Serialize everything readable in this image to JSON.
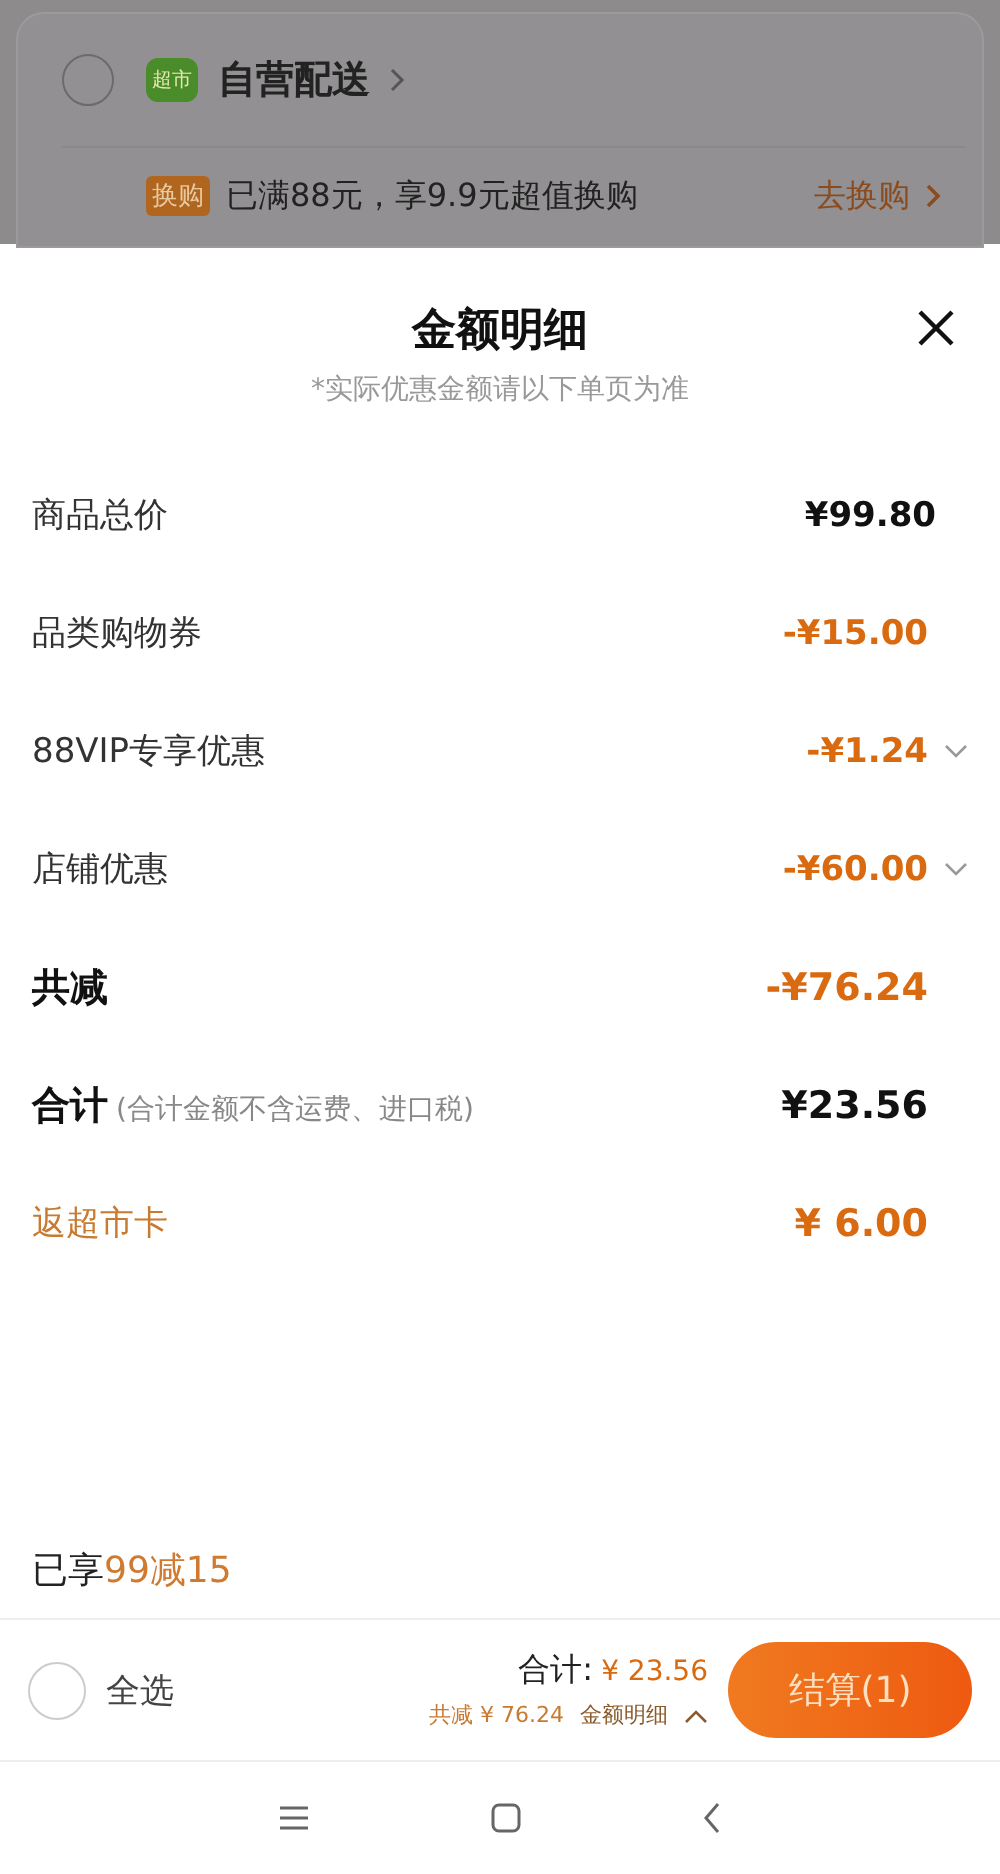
{
  "background_card": {
    "checked": false,
    "store_badge": "超市",
    "store_name": "自营配送",
    "promo_tag": "换购",
    "promo_text": "已满88元，享9.9元超值换购",
    "promo_link": "去换购"
  },
  "sheet": {
    "title": "金额明细",
    "subtitle": "*实际优惠金额请以下单页为准",
    "rows": [
      {
        "kind": "normal",
        "label": "商品总价",
        "value": "¥99.80",
        "expandable": false
      },
      {
        "kind": "discount",
        "label": "品类购物券",
        "value": "-¥15.00",
        "expandable": false
      },
      {
        "kind": "discount",
        "label": "88VIP专享优惠",
        "value": "-¥1.24",
        "expandable": true
      },
      {
        "kind": "discount",
        "label": "店铺优惠",
        "value": "-¥60.00",
        "expandable": true
      },
      {
        "kind": "strong_discount",
        "label": "共减",
        "value": "-¥76.24",
        "expandable": false
      },
      {
        "kind": "total",
        "label": "合计",
        "note": "(合计金额不含运费、进口税)",
        "value": "¥23.56",
        "expandable": false
      },
      {
        "kind": "rebate",
        "label": "返超市卡",
        "value": "¥ 6.00",
        "expandable": false
      }
    ],
    "enjoyed_prefix": "已享",
    "enjoyed_offer": "99减15"
  },
  "footer": {
    "select_all_checked": false,
    "select_all": "全选",
    "total_label": "合计:",
    "total_value": "¥ 23.56",
    "saved": "共减 ¥ 76.24",
    "details_link": "金额明细",
    "checkout": "结算(1)"
  }
}
